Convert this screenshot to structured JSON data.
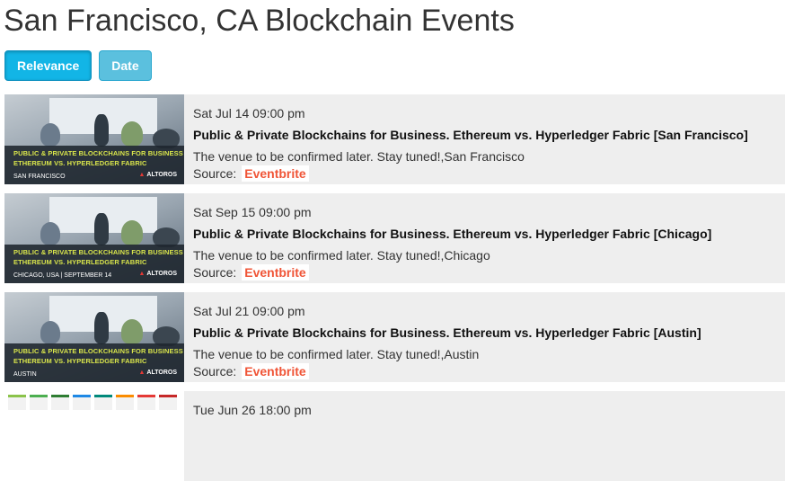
{
  "page": {
    "title": "San Francisco, CA Blockchain Events"
  },
  "sort": {
    "relevance_label": "Relevance",
    "date_label": "Date",
    "active": "relevance"
  },
  "colors": {
    "button": "#5bc0de",
    "button_active": "#12b5e6",
    "eventbrite": "#f05537",
    "row_bg": "#eeeeee"
  },
  "events": [
    {
      "date": "Sat Jul 14 09:00 pm",
      "title": "Public & Private Blockchains for Business. Ethereum vs. Hyperledger Fabric [San Francisco]",
      "venue": "The venue to be confirmed later. Stay tuned!,San Francisco",
      "source_label": "Source:",
      "source": "Eventbrite",
      "image": {
        "line1": "PUBLIC & PRIVATE BLOCKCHAINS FOR BUSINESS",
        "line2": "ETHEREUM VS. HYPERLEDGER FABRIC",
        "location": "SAN FRANCISCO",
        "brand": "ALTOROS"
      }
    },
    {
      "date": "Sat Sep 15 09:00 pm",
      "title": "Public & Private Blockchains for Business. Ethereum vs. Hyperledger Fabric [Chicago]",
      "venue": "The venue to be confirmed later. Stay tuned!,Chicago",
      "source_label": "Source:",
      "source": "Eventbrite",
      "image": {
        "line1": "PUBLIC & PRIVATE BLOCKCHAINS FOR BUSINESS",
        "line2": "ETHEREUM VS. HYPERLEDGER FABRIC",
        "location": "CHICAGO, USA | SEPTEMBER 14",
        "brand": "ALTOROS"
      }
    },
    {
      "date": "Sat Jul 21 09:00 pm",
      "title": "Public & Private Blockchains for Business. Ethereum vs. Hyperledger Fabric [Austin]",
      "venue": "The venue to be confirmed later. Stay tuned!,Austin",
      "source_label": "Source:",
      "source": "Eventbrite",
      "image": {
        "line1": "PUBLIC & PRIVATE BLOCKCHAINS FOR BUSINESS",
        "line2": "ETHEREUM VS. HYPERLEDGER FABRIC",
        "location": "AUSTIN",
        "brand": "ALTOROS"
      }
    },
    {
      "date": "Tue Jun 26 18:00 pm"
    }
  ]
}
